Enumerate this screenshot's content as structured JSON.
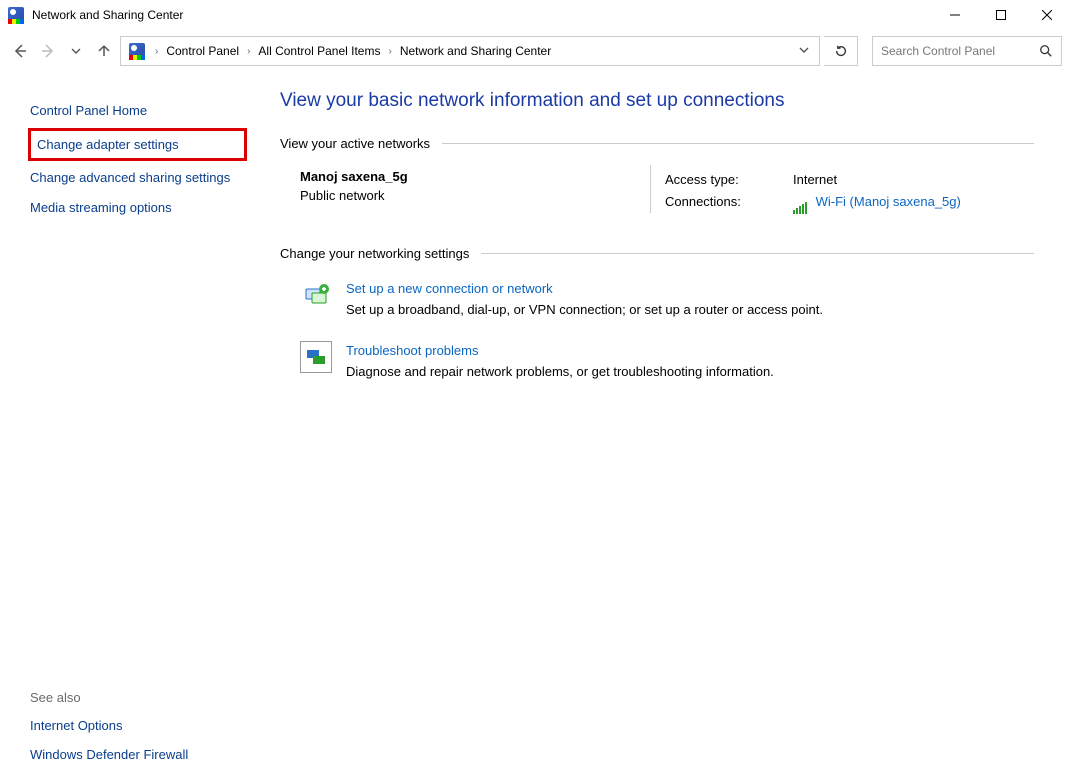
{
  "window": {
    "title": "Network and Sharing Center"
  },
  "breadcrumb": {
    "items": [
      "Control Panel",
      "All Control Panel Items",
      "Network and Sharing Center"
    ]
  },
  "search": {
    "placeholder": "Search Control Panel"
  },
  "sidebar": {
    "home": "Control Panel Home",
    "adapter": "Change adapter settings",
    "advanced": "Change advanced sharing settings",
    "media": "Media streaming options",
    "see_also_label": "See also",
    "see_also": {
      "internet": "Internet Options",
      "firewall": "Windows Defender Firewall"
    }
  },
  "main": {
    "title": "View your basic network information and set up connections",
    "section_active": "View your active networks",
    "network": {
      "name": "Manoj saxena_5g",
      "type": "Public network",
      "access_label": "Access type:",
      "access_value": "Internet",
      "conn_label": "Connections:",
      "conn_value": "Wi-Fi (Manoj saxena_5g)"
    },
    "section_change": "Change your networking settings",
    "setup": {
      "title": "Set up a new connection or network",
      "desc": "Set up a broadband, dial-up, or VPN connection; or set up a router or access point."
    },
    "troubleshoot": {
      "title": "Troubleshoot problems",
      "desc": "Diagnose and repair network problems, or get troubleshooting information."
    }
  }
}
